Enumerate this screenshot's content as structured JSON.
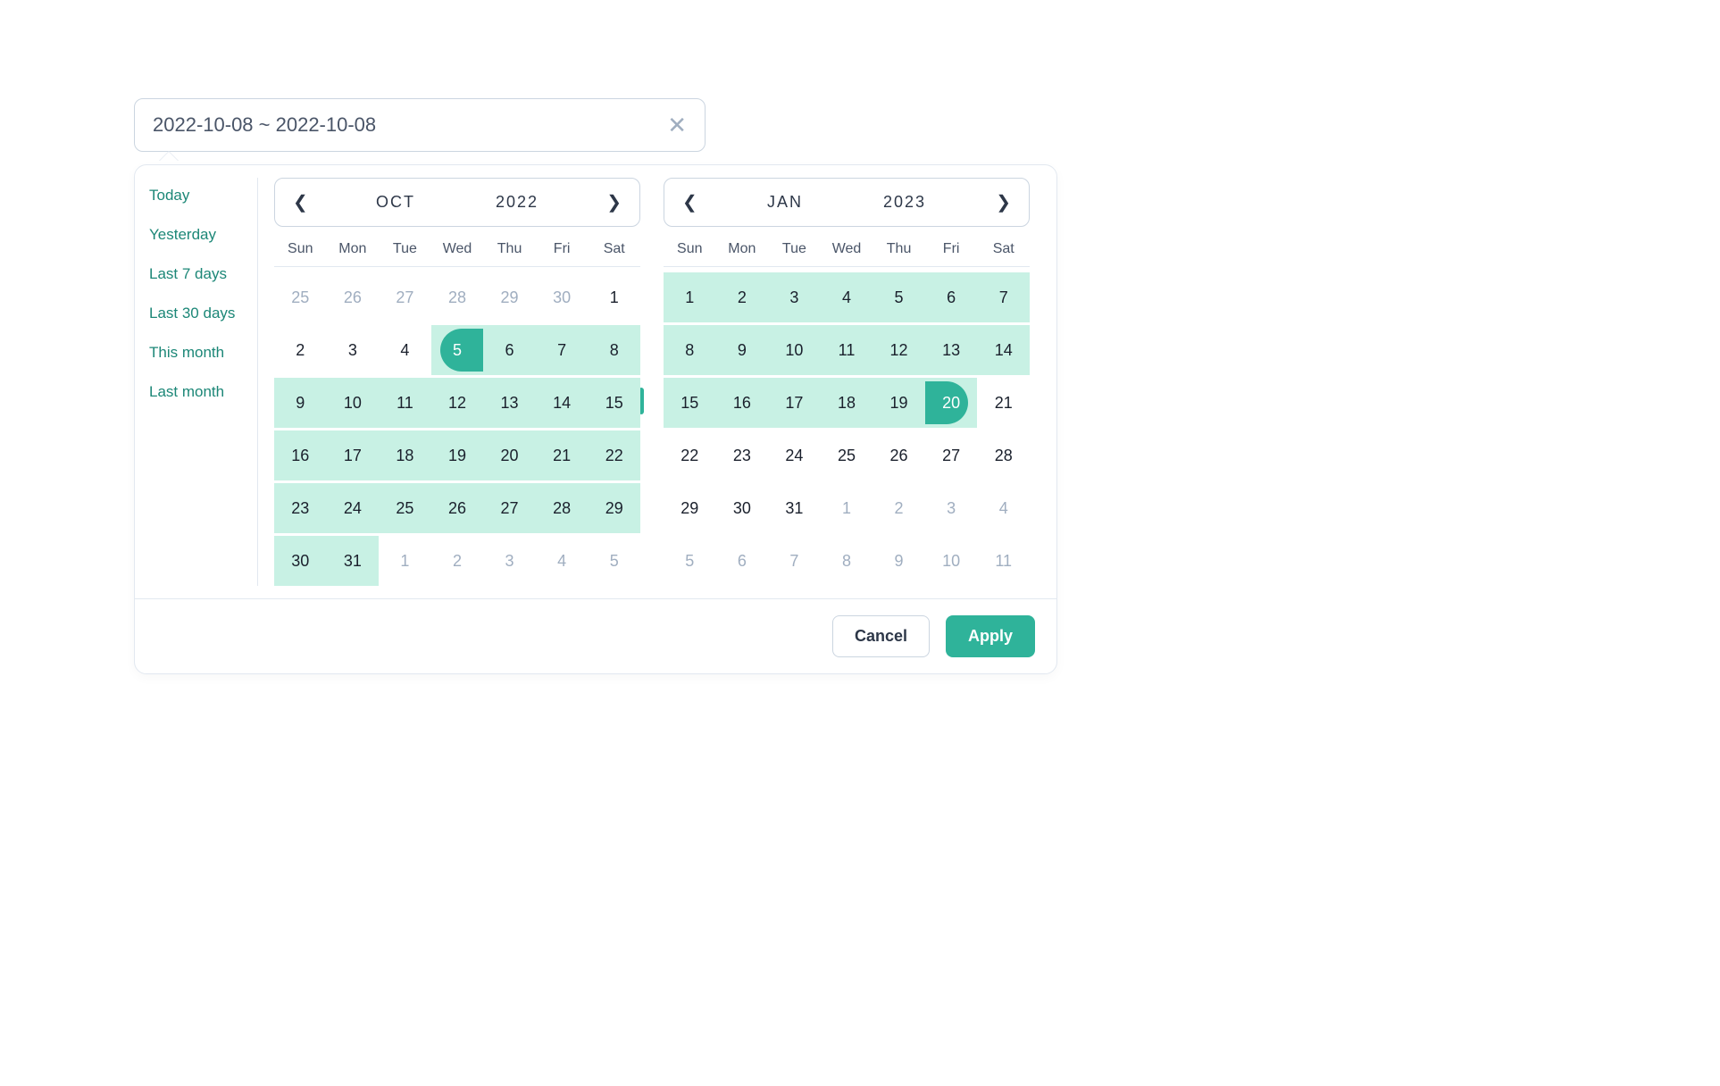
{
  "input": {
    "value": "2022-10-08 ~ 2022-10-08"
  },
  "presets": [
    "Today",
    "Yesterday",
    "Last 7 days",
    "Last 30 days",
    "This month",
    "Last month"
  ],
  "dow": [
    "Sun",
    "Mon",
    "Tue",
    "Wed",
    "Thu",
    "Fri",
    "Sat"
  ],
  "left": {
    "month": "OCT",
    "year": "2022",
    "cells": [
      {
        "d": 25,
        "other": true
      },
      {
        "d": 26,
        "other": true
      },
      {
        "d": 27,
        "other": true
      },
      {
        "d": 28,
        "other": true
      },
      {
        "d": 29,
        "other": true
      },
      {
        "d": 30,
        "other": true
      },
      {
        "d": 1
      },
      {
        "d": 2
      },
      {
        "d": 3
      },
      {
        "d": 4
      },
      {
        "d": 5,
        "start": true
      },
      {
        "d": 6,
        "in": true
      },
      {
        "d": 7,
        "in": true
      },
      {
        "d": 8,
        "in": true
      },
      {
        "d": 9,
        "in": true
      },
      {
        "d": 10,
        "in": true
      },
      {
        "d": 11,
        "in": true
      },
      {
        "d": 12,
        "in": true
      },
      {
        "d": 13,
        "in": true
      },
      {
        "d": 14,
        "in": true
      },
      {
        "d": 15,
        "in": true
      },
      {
        "d": 16,
        "in": true
      },
      {
        "d": 17,
        "in": true
      },
      {
        "d": 18,
        "in": true
      },
      {
        "d": 19,
        "in": true
      },
      {
        "d": 20,
        "in": true
      },
      {
        "d": 21,
        "in": true
      },
      {
        "d": 22,
        "in": true
      },
      {
        "d": 23,
        "in": true
      },
      {
        "d": 24,
        "in": true
      },
      {
        "d": 25,
        "in": true
      },
      {
        "d": 26,
        "in": true
      },
      {
        "d": 27,
        "in": true
      },
      {
        "d": 28,
        "in": true
      },
      {
        "d": 29,
        "in": true
      },
      {
        "d": 30,
        "in": true
      },
      {
        "d": 31,
        "in": true
      },
      {
        "d": 1,
        "other": true
      },
      {
        "d": 2,
        "other": true
      },
      {
        "d": 3,
        "other": true
      },
      {
        "d": 4,
        "other": true
      },
      {
        "d": 5,
        "other": true
      }
    ]
  },
  "right": {
    "month": "JAN",
    "year": "2023",
    "cells": [
      {
        "d": 1,
        "in": true
      },
      {
        "d": 2,
        "in": true
      },
      {
        "d": 3,
        "in": true
      },
      {
        "d": 4,
        "in": true
      },
      {
        "d": 5,
        "in": true
      },
      {
        "d": 6,
        "in": true
      },
      {
        "d": 7,
        "in": true
      },
      {
        "d": 8,
        "in": true
      },
      {
        "d": 9,
        "in": true
      },
      {
        "d": 10,
        "in": true
      },
      {
        "d": 11,
        "in": true
      },
      {
        "d": 12,
        "in": true
      },
      {
        "d": 13,
        "in": true
      },
      {
        "d": 14,
        "in": true
      },
      {
        "d": 15,
        "in": true
      },
      {
        "d": 16,
        "in": true
      },
      {
        "d": 17,
        "in": true
      },
      {
        "d": 18,
        "in": true
      },
      {
        "d": 19,
        "in": true
      },
      {
        "d": 20,
        "end": true
      },
      {
        "d": 21
      },
      {
        "d": 22
      },
      {
        "d": 23
      },
      {
        "d": 24
      },
      {
        "d": 25
      },
      {
        "d": 26
      },
      {
        "d": 27
      },
      {
        "d": 28
      },
      {
        "d": 29
      },
      {
        "d": 30
      },
      {
        "d": 31
      },
      {
        "d": 1,
        "other": true
      },
      {
        "d": 2,
        "other": true
      },
      {
        "d": 3,
        "other": true
      },
      {
        "d": 4,
        "other": true
      },
      {
        "d": 5,
        "other": true
      },
      {
        "d": 6,
        "other": true
      },
      {
        "d": 7,
        "other": true
      },
      {
        "d": 8,
        "other": true
      },
      {
        "d": 9,
        "other": true
      },
      {
        "d": 10,
        "other": true
      },
      {
        "d": 11,
        "other": true
      }
    ]
  },
  "footer": {
    "cancel": "Cancel",
    "apply": "Apply"
  }
}
